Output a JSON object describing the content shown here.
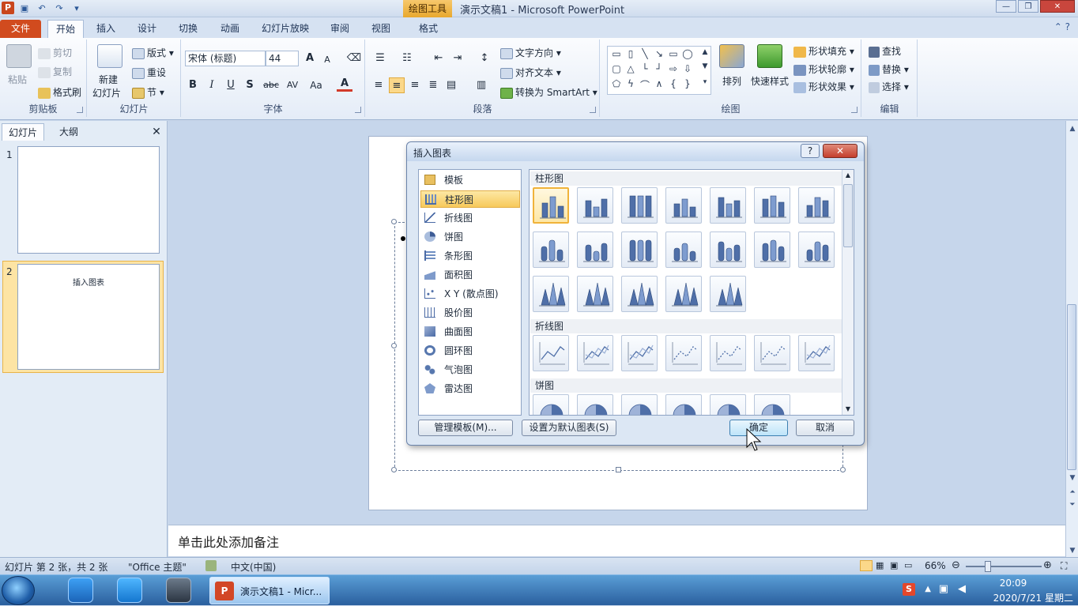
{
  "titlebar": {
    "context_tab": "绘图工具",
    "title": "演示文稿1  -  Microsoft PowerPoint",
    "qat_items": [
      "save-icon",
      "undo-icon",
      "redo-icon",
      "customize-icon"
    ]
  },
  "tabs": [
    {
      "label": "文件",
      "state": "file"
    },
    {
      "label": "开始",
      "state": "active"
    },
    {
      "label": "插入"
    },
    {
      "label": "设计"
    },
    {
      "label": "切换"
    },
    {
      "label": "动画"
    },
    {
      "label": "幻灯片放映"
    },
    {
      "label": "审阅"
    },
    {
      "label": "视图"
    },
    {
      "label": "格式"
    }
  ],
  "ribbon": {
    "clipboard": {
      "label": "剪贴板",
      "paste": "粘贴",
      "cut": "剪切",
      "copy": "复制",
      "format_painter": "格式刷"
    },
    "slides": {
      "label": "幻灯片",
      "new_slide_1": "新建",
      "new_slide_2": "幻灯片",
      "layout": "版式",
      "reset": "重设",
      "section": "节"
    },
    "font": {
      "label": "字体",
      "font_name": "宋体 (标题)",
      "font_size": "44",
      "bold": "B",
      "italic": "I",
      "underline": "U",
      "shadow": "S",
      "strike": "abc",
      "spacing": "AV",
      "case": "Aa",
      "color": "A",
      "grow": "A",
      "shrink": "A"
    },
    "paragraph": {
      "label": "段落",
      "text_direction": "文字方向",
      "align_text": "对齐文本",
      "smartart": "转换为 SmartArt"
    },
    "drawing": {
      "label": "绘图",
      "arrange": "排列",
      "quick_styles": "快速样式",
      "shape_fill": "形状填充",
      "shape_outline": "形状轮廓",
      "shape_effects": "形状效果"
    },
    "editing": {
      "label": "编辑",
      "find": "查找",
      "replace": "替换",
      "select": "选择"
    }
  },
  "left_panel": {
    "tab_slides": "幻灯片",
    "tab_outline": "大纲",
    "close": "✕",
    "slides": [
      {
        "number": "1",
        "title": ""
      },
      {
        "number": "2",
        "title": "插入图表"
      }
    ]
  },
  "notes": {
    "placeholder": "单击此处添加备注"
  },
  "dialog": {
    "title": "插入图表",
    "help": "?",
    "close": "✕",
    "chart_types": [
      {
        "label": "模板",
        "icon": "folder-icon"
      },
      {
        "label": "柱形图",
        "icon": "column-chart-icon",
        "selected": true
      },
      {
        "label": "折线图",
        "icon": "line-chart-icon"
      },
      {
        "label": "饼图",
        "icon": "pie-chart-icon"
      },
      {
        "label": "条形图",
        "icon": "bar-chart-icon"
      },
      {
        "label": "面积图",
        "icon": "area-chart-icon"
      },
      {
        "label": "X Y (散点图)",
        "icon": "scatter-chart-icon"
      },
      {
        "label": "股价图",
        "icon": "stock-chart-icon"
      },
      {
        "label": "曲面图",
        "icon": "surface-chart-icon"
      },
      {
        "label": "圆环图",
        "icon": "doughnut-chart-icon"
      },
      {
        "label": "气泡图",
        "icon": "bubble-chart-icon"
      },
      {
        "label": "雷达图",
        "icon": "radar-chart-icon"
      }
    ],
    "sections": {
      "column": "柱形图",
      "line": "折线图",
      "pie": "饼图"
    },
    "manage_templates": "管理模板(M)...",
    "set_default": "设置为默认图表(S)",
    "ok": "确定",
    "cancel": "取消"
  },
  "status": {
    "slide_info": "幻灯片 第 2 张，共 2 张",
    "theme": "\"Office 主题\"",
    "language": "中文(中国)",
    "zoom": "66%"
  },
  "taskbar": {
    "app_label": "演示文稿1 - Micr...",
    "time": "20:09",
    "date": "2020/7/21 星期二"
  },
  "colors": {
    "accent": "#f7c95a",
    "file_tab": "#d14b1e",
    "ribbon_bg": "#e4ecf7",
    "taskbar": "#2a5f9e"
  }
}
